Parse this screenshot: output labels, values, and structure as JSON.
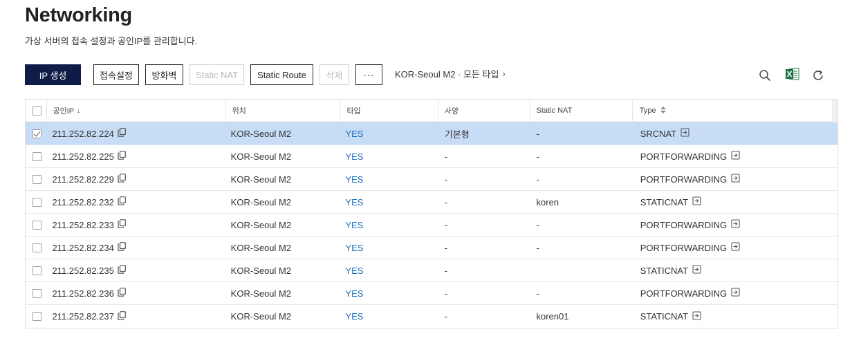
{
  "page": {
    "title": "Networking",
    "subtitle": "가상 서버의 접속 설정과 공인IP를 관리합니다."
  },
  "toolbar": {
    "create_ip": "IP 생성",
    "access_settings": "접속설정",
    "firewall": "방화벽",
    "static_nat": "Static NAT",
    "static_route": "Static Route",
    "delete": "삭제",
    "more": "···",
    "region_filter": "KOR-Seoul M2 · 모든 타입",
    "region_chevron": "›"
  },
  "tool_icons": [
    "search-icon",
    "excel-export-icon",
    "refresh-icon"
  ],
  "colors": {
    "primary_button": "#0f1c48",
    "selected_row": "#c7dcf5",
    "link_yes": "#1b6ec2",
    "excel_green": "#1e7145"
  },
  "table": {
    "headers": [
      "공인IP",
      "위치",
      "타입",
      "사양",
      "Static NAT",
      "Type"
    ],
    "sort_indicator": "↓",
    "rows": [
      {
        "ip": "211.252.82.224",
        "location": "KOR-Seoul M2",
        "type": "YES",
        "spec": "기본형",
        "static_nat": "-",
        "nat_type": "SRCNAT",
        "checked": true
      },
      {
        "ip": "211.252.82.225",
        "location": "KOR-Seoul M2",
        "type": "YES",
        "spec": "-",
        "static_nat": "-",
        "nat_type": "PORTFORWARDING",
        "checked": false
      },
      {
        "ip": "211.252.82.229",
        "location": "KOR-Seoul M2",
        "type": "YES",
        "spec": "-",
        "static_nat": "-",
        "nat_type": "PORTFORWARDING",
        "checked": false
      },
      {
        "ip": "211.252.82.232",
        "location": "KOR-Seoul M2",
        "type": "YES",
        "spec": "-",
        "static_nat": "koren",
        "nat_type": "STATICNAT",
        "checked": false
      },
      {
        "ip": "211.252.82.233",
        "location": "KOR-Seoul M2",
        "type": "YES",
        "spec": "-",
        "static_nat": "-",
        "nat_type": "PORTFORWARDING",
        "checked": false
      },
      {
        "ip": "211.252.82.234",
        "location": "KOR-Seoul M2",
        "type": "YES",
        "spec": "-",
        "static_nat": "-",
        "nat_type": "PORTFORWARDING",
        "checked": false
      },
      {
        "ip": "211.252.82.235",
        "location": "KOR-Seoul M2",
        "type": "YES",
        "spec": "-",
        "static_nat": "",
        "nat_type": "STATICNAT",
        "checked": false
      },
      {
        "ip": "211.252.82.236",
        "location": "KOR-Seoul M2",
        "type": "YES",
        "spec": "-",
        "static_nat": "-",
        "nat_type": "PORTFORWARDING",
        "checked": false
      },
      {
        "ip": "211.252.82.237",
        "location": "KOR-Seoul M2",
        "type": "YES",
        "spec": "-",
        "static_nat": "koren01",
        "nat_type": "STATICNAT",
        "checked": false
      }
    ]
  }
}
